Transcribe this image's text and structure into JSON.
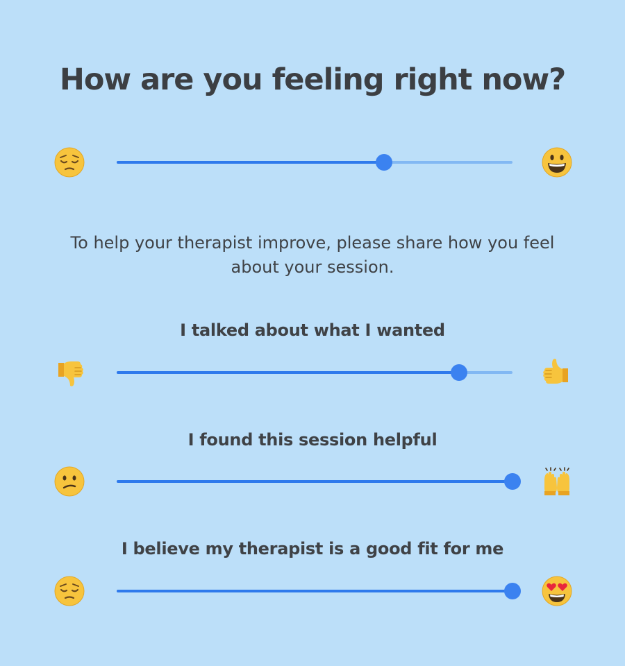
{
  "title": "How are you feeling right now?",
  "intro": "To help your therapist improve, please share how you feel about your session.",
  "colors": {
    "background": "#bcdff9",
    "track_active": "#2f7aec",
    "track_inactive": "#82b8f3",
    "thumb": "#3b82f0",
    "text": "#3f4246"
  },
  "mood_slider": {
    "value": 0.675,
    "left_icon": "pensive-face-emoji",
    "right_icon": "grinning-face-emoji"
  },
  "questions": [
    {
      "label": "I talked about what I wanted",
      "value": 0.865,
      "left_icon": "thumbs-down-emoji",
      "right_icon": "thumbs-up-emoji"
    },
    {
      "label": "I found this session helpful",
      "value": 1.0,
      "left_icon": "confused-face-emoji",
      "right_icon": "raising-hands-emoji"
    },
    {
      "label": "I believe my therapist is a good fit for me",
      "value": 1.0,
      "left_icon": "pensive-face-emoji",
      "right_icon": "heart-eyes-face-emoji"
    }
  ]
}
